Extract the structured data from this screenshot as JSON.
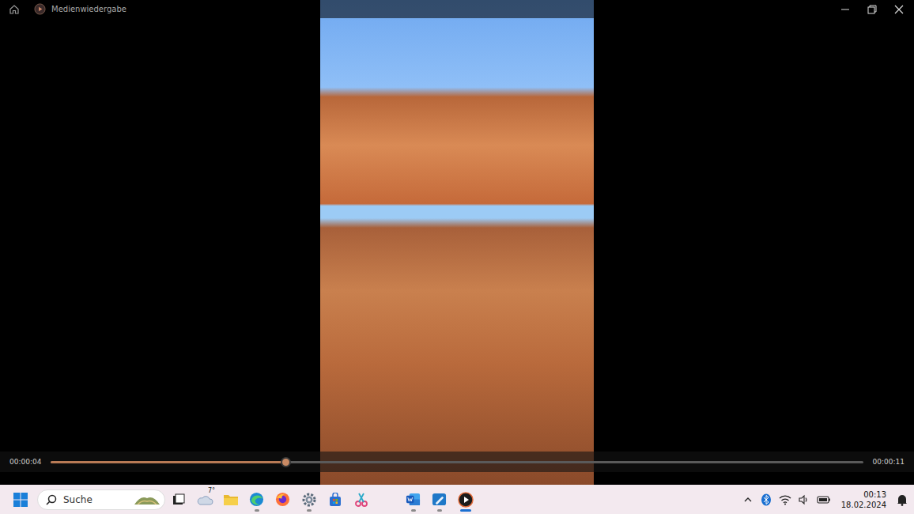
{
  "window": {
    "title": "Medienwiedergabe"
  },
  "player": {
    "elapsed": "00:00:04",
    "duration": "00:00:11",
    "level": 0.289
  },
  "taskbar": {
    "search": {
      "placeholder": "Suche"
    },
    "weather": {
      "temperature": "7°"
    },
    "apps": [
      {
        "running": false,
        "active": false
      },
      {
        "running": true,
        "active": false
      },
      {
        "running": false,
        "active": false
      },
      {
        "running": true,
        "active": false
      },
      {
        "running": false,
        "active": false
      },
      {
        "running": false,
        "active": false
      },
      {
        "running": true,
        "active": false
      },
      {
        "running": true,
        "active": false
      },
      {
        "running": true,
        "active": false
      },
      {
        "running": true,
        "active": true
      }
    ],
    "clock": {
      "time": "00:13",
      "date": "18.02.2024"
    }
  }
}
